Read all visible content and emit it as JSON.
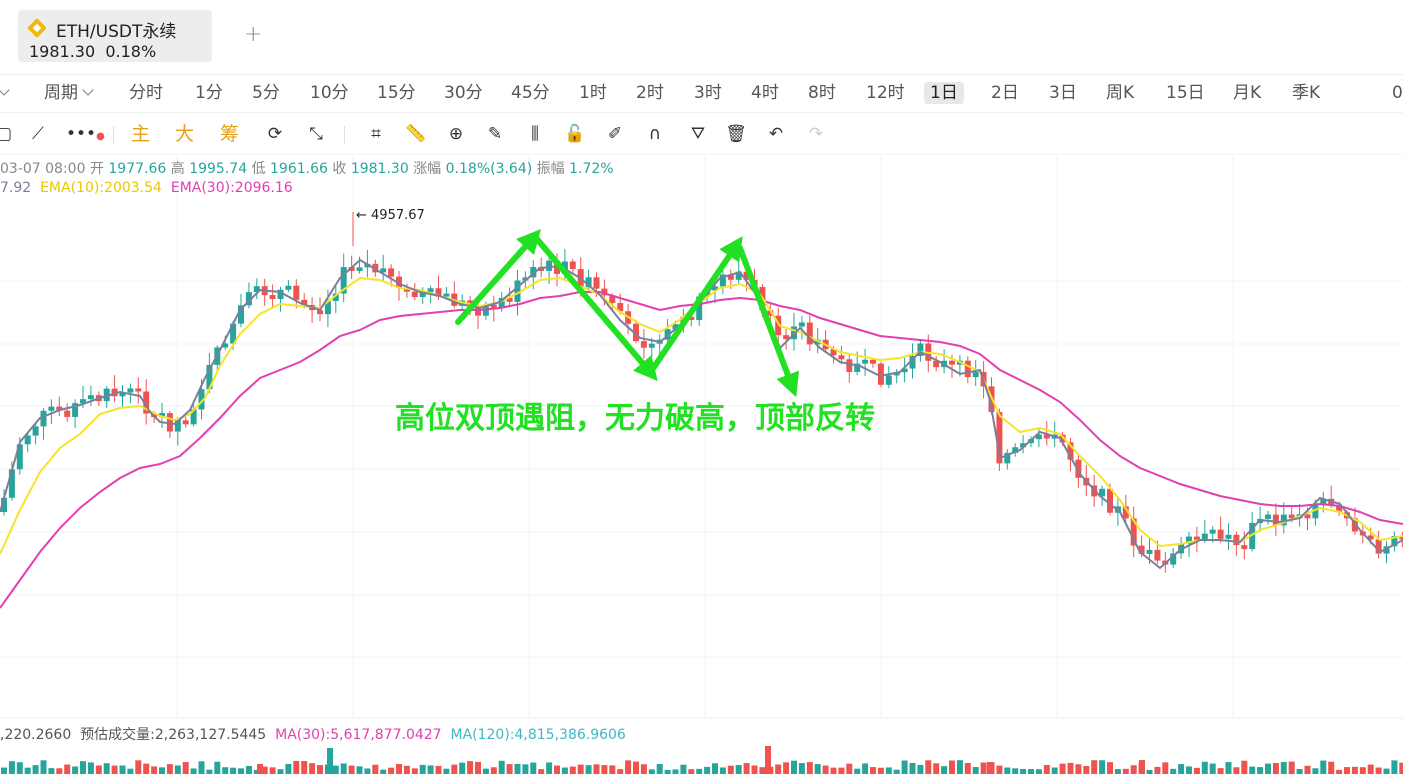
{
  "tab": {
    "title": "ETH/USDT永续",
    "price": "1981.30",
    "change": "0.18%",
    "add": "+"
  },
  "intervals": {
    "left_chevron": "〉",
    "period_label": "周期",
    "items": [
      "分时",
      "1分",
      "5分",
      "10分",
      "15分",
      "30分",
      "45分",
      "1时",
      "2时",
      "3时",
      "4时",
      "8时",
      "12时",
      "1日",
      "2日",
      "3日",
      "周K",
      "15日",
      "月K",
      "季K"
    ],
    "active": "1日",
    "trailing": "0"
  },
  "toolbar": {
    "main": "主",
    "big": "大",
    "chip": "筹"
  },
  "ohlc": {
    "date": "03-07 08:00",
    "open_label": "开",
    "open": "1977.66",
    "high_label": "高",
    "high": "1995.74",
    "low_label": "低",
    "low": "1961.66",
    "close_label": "收",
    "close": "1981.30",
    "chg_label": "涨幅",
    "chg": "0.18%(3.64)",
    "amp_label": "振幅",
    "amp": "1.72%"
  },
  "ema": {
    "ema5_tail": "7.92",
    "ema10": "EMA(10):2003.54",
    "ema30": "EMA(30):2096.16"
  },
  "volume": {
    "first": ",220.2660",
    "est": "预估成交量:2,263,127.5445",
    "ma30": "MA(30):5,617,877.0427",
    "ma120": "MA(120):4,815,386.9606"
  },
  "colors": {
    "up": "#26a69a",
    "down": "#ef5350",
    "ema5": "#7b7f9e",
    "ema10": "#f5e42a",
    "ema30": "#e040b0",
    "annotation": "#22e022",
    "accent": "#f0b90b",
    "ma120": "#3fb6c9"
  },
  "chart_data": {
    "type": "candlestick",
    "max_label": "4957.67",
    "annotation": "高位双顶遇阻，无力破高，顶部反转",
    "series": {
      "ema5": [
        [
          0,
          512
        ],
        [
          20,
          442
        ],
        [
          40,
          418
        ],
        [
          60,
          410
        ],
        [
          80,
          405
        ],
        [
          100,
          398
        ],
        [
          120,
          392
        ],
        [
          140,
          396
        ],
        [
          150,
          412
        ],
        [
          160,
          422
        ],
        [
          175,
          424
        ],
        [
          190,
          410
        ],
        [
          205,
          378
        ],
        [
          220,
          350
        ],
        [
          240,
          310
        ],
        [
          260,
          290
        ],
        [
          280,
          292
        ],
        [
          300,
          303
        ],
        [
          320,
          310
        ],
        [
          340,
          278
        ],
        [
          360,
          260
        ],
        [
          380,
          272
        ],
        [
          400,
          284
        ],
        [
          420,
          292
        ],
        [
          440,
          296
        ],
        [
          460,
          304
        ],
        [
          480,
          308
        ],
        [
          500,
          302
        ],
        [
          520,
          285
        ],
        [
          540,
          268
        ],
        [
          560,
          266
        ],
        [
          580,
          278
        ],
        [
          600,
          295
        ],
        [
          620,
          320
        ],
        [
          640,
          338
        ],
        [
          660,
          342
        ],
        [
          680,
          325
        ],
        [
          700,
          302
        ],
        [
          720,
          278
        ],
        [
          740,
          272
        ],
        [
          760,
          300
        ],
        [
          780,
          348
        ],
        [
          800,
          328
        ],
        [
          820,
          348
        ],
        [
          840,
          362
        ],
        [
          860,
          366
        ],
        [
          880,
          376
        ],
        [
          900,
          372
        ],
        [
          920,
          352
        ],
        [
          940,
          362
        ],
        [
          960,
          374
        ],
        [
          980,
          370
        ],
        [
          990,
          400
        ],
        [
          1000,
          458
        ],
        [
          1020,
          450
        ],
        [
          1040,
          432
        ],
        [
          1060,
          438
        ],
        [
          1080,
          474
        ],
        [
          1100,
          496
        ],
        [
          1120,
          512
        ],
        [
          1140,
          552
        ],
        [
          1160,
          568
        ],
        [
          1180,
          550
        ],
        [
          1200,
          540
        ],
        [
          1220,
          540
        ],
        [
          1240,
          542
        ],
        [
          1260,
          520
        ],
        [
          1280,
          522
        ],
        [
          1300,
          518
        ],
        [
          1320,
          498
        ],
        [
          1340,
          504
        ],
        [
          1360,
          530
        ],
        [
          1380,
          552
        ],
        [
          1403,
          540
        ]
      ],
      "ema10": [
        [
          0,
          554
        ],
        [
          20,
          510
        ],
        [
          40,
          472
        ],
        [
          60,
          448
        ],
        [
          80,
          434
        ],
        [
          100,
          414
        ],
        [
          120,
          408
        ],
        [
          140,
          406
        ],
        [
          160,
          416
        ],
        [
          175,
          420
        ],
        [
          190,
          414
        ],
        [
          205,
          398
        ],
        [
          220,
          366
        ],
        [
          240,
          334
        ],
        [
          260,
          314
        ],
        [
          280,
          304
        ],
        [
          300,
          306
        ],
        [
          320,
          308
        ],
        [
          340,
          292
        ],
        [
          360,
          278
        ],
        [
          380,
          280
        ],
        [
          400,
          288
        ],
        [
          420,
          290
        ],
        [
          440,
          296
        ],
        [
          460,
          302
        ],
        [
          480,
          306
        ],
        [
          500,
          302
        ],
        [
          520,
          292
        ],
        [
          540,
          280
        ],
        [
          560,
          278
        ],
        [
          580,
          286
        ],
        [
          600,
          295
        ],
        [
          620,
          312
        ],
        [
          640,
          324
        ],
        [
          660,
          332
        ],
        [
          680,
          320
        ],
        [
          700,
          302
        ],
        [
          720,
          288
        ],
        [
          740,
          284
        ],
        [
          760,
          294
        ],
        [
          780,
          326
        ],
        [
          800,
          332
        ],
        [
          820,
          342
        ],
        [
          840,
          352
        ],
        [
          860,
          356
        ],
        [
          880,
          360
        ],
        [
          900,
          358
        ],
        [
          920,
          352
        ],
        [
          940,
          354
        ],
        [
          960,
          362
        ],
        [
          980,
          372
        ],
        [
          1000,
          416
        ],
        [
          1020,
          432
        ],
        [
          1040,
          428
        ],
        [
          1060,
          434
        ],
        [
          1080,
          456
        ],
        [
          1100,
          476
        ],
        [
          1120,
          500
        ],
        [
          1140,
          530
        ],
        [
          1160,
          546
        ],
        [
          1180,
          544
        ],
        [
          1200,
          540
        ],
        [
          1220,
          540
        ],
        [
          1240,
          542
        ],
        [
          1260,
          530
        ],
        [
          1280,
          524
        ],
        [
          1300,
          516
        ],
        [
          1320,
          508
        ],
        [
          1340,
          512
        ],
        [
          1360,
          522
        ],
        [
          1380,
          540
        ],
        [
          1403,
          536
        ]
      ],
      "ema30": [
        [
          0,
          608
        ],
        [
          20,
          580
        ],
        [
          40,
          552
        ],
        [
          60,
          528
        ],
        [
          80,
          508
        ],
        [
          100,
          492
        ],
        [
          120,
          478
        ],
        [
          140,
          468
        ],
        [
          160,
          464
        ],
        [
          180,
          456
        ],
        [
          200,
          438
        ],
        [
          220,
          418
        ],
        [
          240,
          396
        ],
        [
          260,
          378
        ],
        [
          280,
          370
        ],
        [
          300,
          362
        ],
        [
          320,
          350
        ],
        [
          340,
          336
        ],
        [
          360,
          330
        ],
        [
          380,
          320
        ],
        [
          400,
          316
        ],
        [
          420,
          314
        ],
        [
          440,
          312
        ],
        [
          460,
          310
        ],
        [
          480,
          310
        ],
        [
          500,
          308
        ],
        [
          520,
          304
        ],
        [
          540,
          298
        ],
        [
          560,
          296
        ],
        [
          580,
          292
        ],
        [
          600,
          292
        ],
        [
          620,
          298
        ],
        [
          640,
          304
        ],
        [
          660,
          310
        ],
        [
          680,
          306
        ],
        [
          700,
          304
        ],
        [
          720,
          300
        ],
        [
          740,
          298
        ],
        [
          760,
          300
        ],
        [
          780,
          306
        ],
        [
          800,
          310
        ],
        [
          820,
          318
        ],
        [
          840,
          324
        ],
        [
          860,
          330
        ],
        [
          880,
          336
        ],
        [
          900,
          338
        ],
        [
          920,
          340
        ],
        [
          940,
          342
        ],
        [
          960,
          346
        ],
        [
          980,
          354
        ],
        [
          1000,
          370
        ],
        [
          1020,
          380
        ],
        [
          1040,
          390
        ],
        [
          1060,
          402
        ],
        [
          1080,
          420
        ],
        [
          1100,
          440
        ],
        [
          1120,
          456
        ],
        [
          1140,
          468
        ],
        [
          1160,
          476
        ],
        [
          1180,
          484
        ],
        [
          1200,
          490
        ],
        [
          1220,
          496
        ],
        [
          1240,
          500
        ],
        [
          1260,
          504
        ],
        [
          1280,
          506
        ],
        [
          1300,
          506
        ],
        [
          1320,
          504
        ],
        [
          1340,
          506
        ],
        [
          1360,
          512
        ],
        [
          1380,
          520
        ],
        [
          1403,
          524
        ]
      ]
    }
  }
}
